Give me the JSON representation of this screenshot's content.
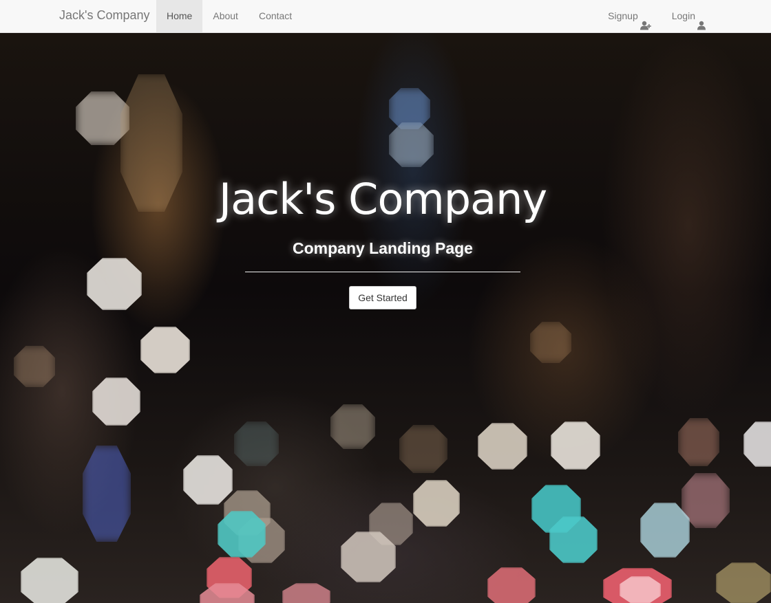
{
  "navbar": {
    "brand": "Jack's Company",
    "left_items": [
      {
        "label": "Home",
        "active": true
      },
      {
        "label": "About",
        "active": false
      },
      {
        "label": "Contact",
        "active": false
      }
    ],
    "right_items": [
      {
        "label": "Signup",
        "icon": "user-plus-icon"
      },
      {
        "label": "Login",
        "icon": "user-icon"
      }
    ]
  },
  "hero": {
    "title": "Jack's Company",
    "subtitle": "Company Landing Page",
    "button_label": "Get Started"
  },
  "colors": {
    "navbar_bg": "#f8f8f8",
    "nav_active_bg": "#e7e7e7",
    "nav_text": "#777777",
    "hero_text": "#ffffff",
    "button_bg": "#ffffff"
  }
}
